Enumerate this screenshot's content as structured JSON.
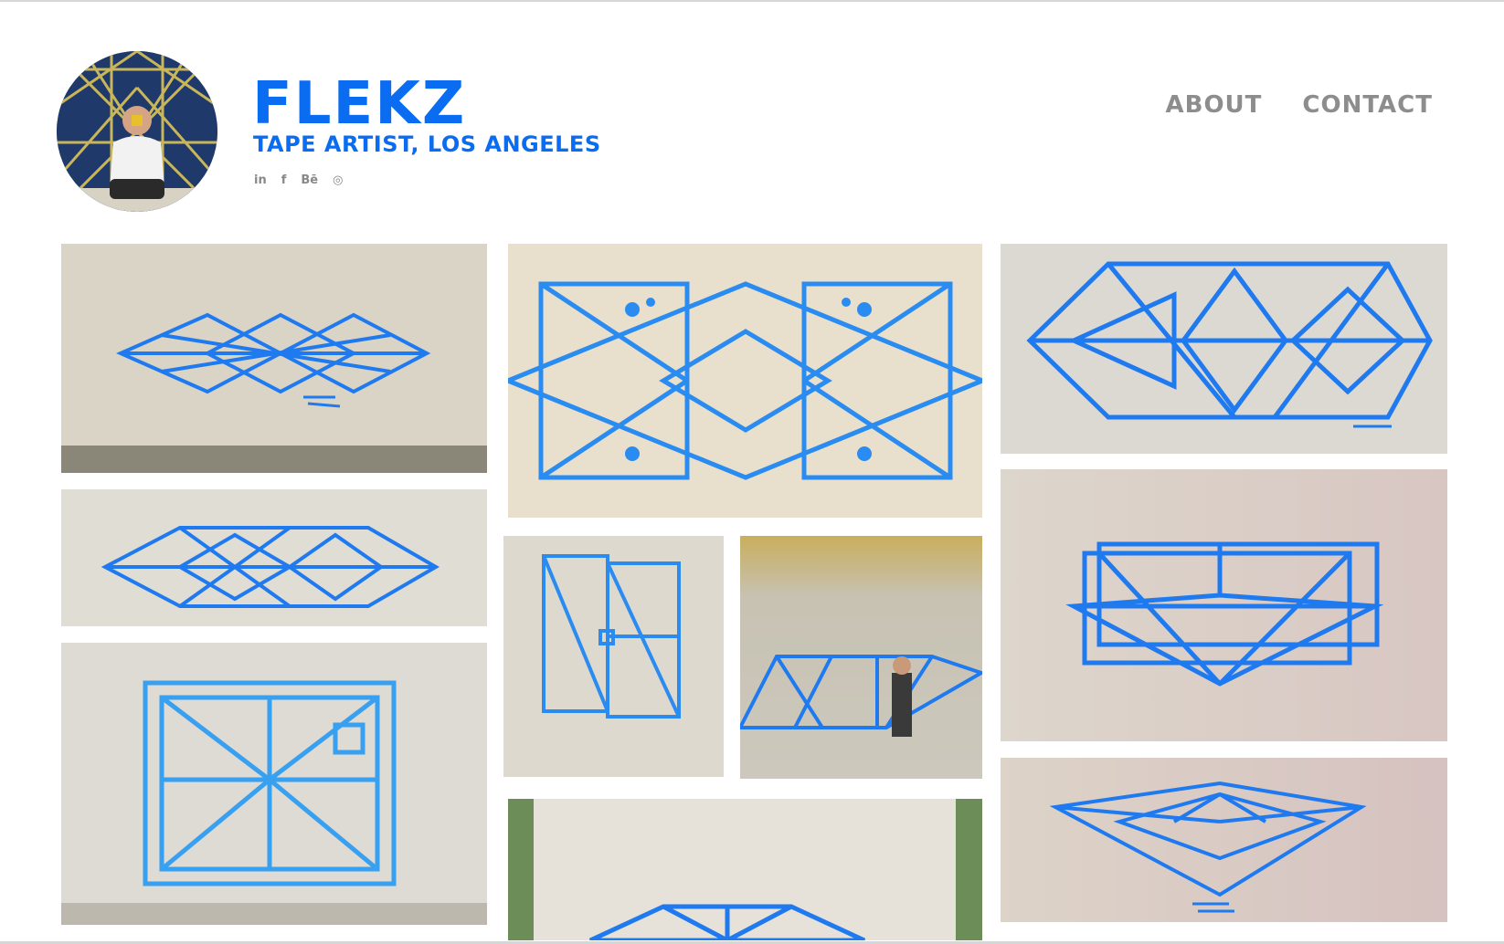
{
  "site": {
    "title": "FLEKZ",
    "subtitle": "TAPE ARTIST, LOS ANGELES"
  },
  "social": [
    {
      "label": "in",
      "icon": "linkedin-icon"
    },
    {
      "label": "f",
      "icon": "facebook-icon"
    },
    {
      "label": "Bē",
      "icon": "behance-icon"
    },
    {
      "label": "◎",
      "icon": "instagram-icon"
    }
  ],
  "nav": {
    "about": "ABOUT",
    "contact": "CONTACT"
  },
  "colors": {
    "accent": "#0a6cf0",
    "tape": "#1f7af0",
    "nav": "#8d8d8d"
  }
}
